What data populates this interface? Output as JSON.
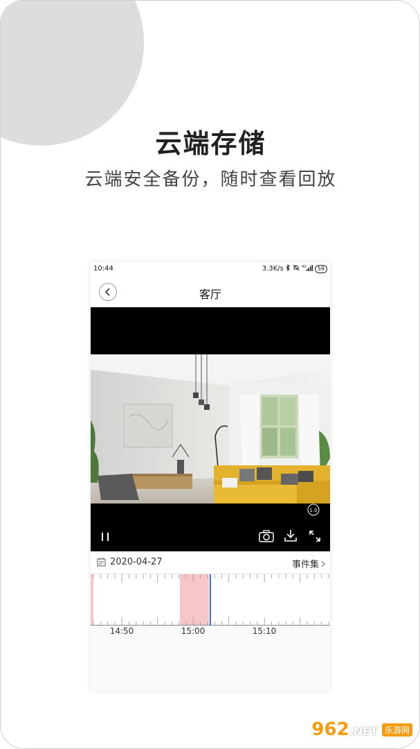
{
  "hero": {
    "title": "云端存储",
    "subtitle": "云端安全备份，随时查看回放"
  },
  "status_bar": {
    "time": "10:44",
    "speed": "3.3K/s",
    "battery": "59"
  },
  "nav": {
    "title": "客厅"
  },
  "player": {
    "speed_badge": "1.0",
    "controls": [
      "pause-icon",
      "camera-icon",
      "download-icon",
      "fullscreen-icon"
    ]
  },
  "date_bar": {
    "date": "2020-04-27",
    "events_label": "事件集"
  },
  "timeline": {
    "labels": [
      "14:50",
      "15:00",
      "15:10"
    ],
    "recorded_color": "#f6c6c8",
    "cursor_color": "#3b6fe0"
  },
  "watermark": {
    "logo": "962",
    "suffix": ".NET",
    "text": "乐游网"
  }
}
